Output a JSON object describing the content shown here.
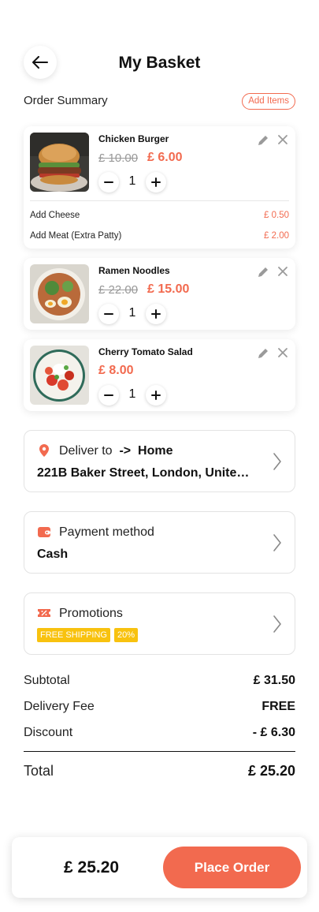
{
  "header": {
    "title": "My Basket",
    "back_icon": "arrow-left-icon"
  },
  "summary": {
    "label": "Order Summary",
    "add_items": "Add Items"
  },
  "items": [
    {
      "name": "Chicken Burger",
      "old_price": "£ 10.00",
      "price": "£ 6.00",
      "qty": "1",
      "addons": [
        {
          "label": "Add Cheese",
          "price": "£ 0.50"
        },
        {
          "label": "Add Meat (Extra Patty)",
          "price": "£ 2.00"
        }
      ]
    },
    {
      "name": "Ramen Noodles",
      "old_price": "£ 22.00",
      "price": "£ 15.00",
      "qty": "1"
    },
    {
      "name": "Cherry Tomato Salad",
      "price": "£ 8.00",
      "qty": "1"
    }
  ],
  "delivery": {
    "label": "Deliver to",
    "arrow": "->",
    "place": "Home",
    "address": "221B Baker Street, London, United K..."
  },
  "payment": {
    "label": "Payment method",
    "value": "Cash"
  },
  "promotions": {
    "label": "Promotions",
    "tags": [
      "FREE SHIPPING",
      "20%"
    ]
  },
  "totals": {
    "subtotal_label": "Subtotal",
    "subtotal": "£ 31.50",
    "delivery_label": "Delivery Fee",
    "delivery": "FREE",
    "discount_label": "Discount",
    "discount": "- £ 6.30",
    "total_label": "Total",
    "total": "£ 25.20"
  },
  "footer": {
    "total": "£ 25.20",
    "button": "Place Order"
  },
  "colors": {
    "accent": "#f26a4f",
    "tag": "#f8c20f"
  }
}
